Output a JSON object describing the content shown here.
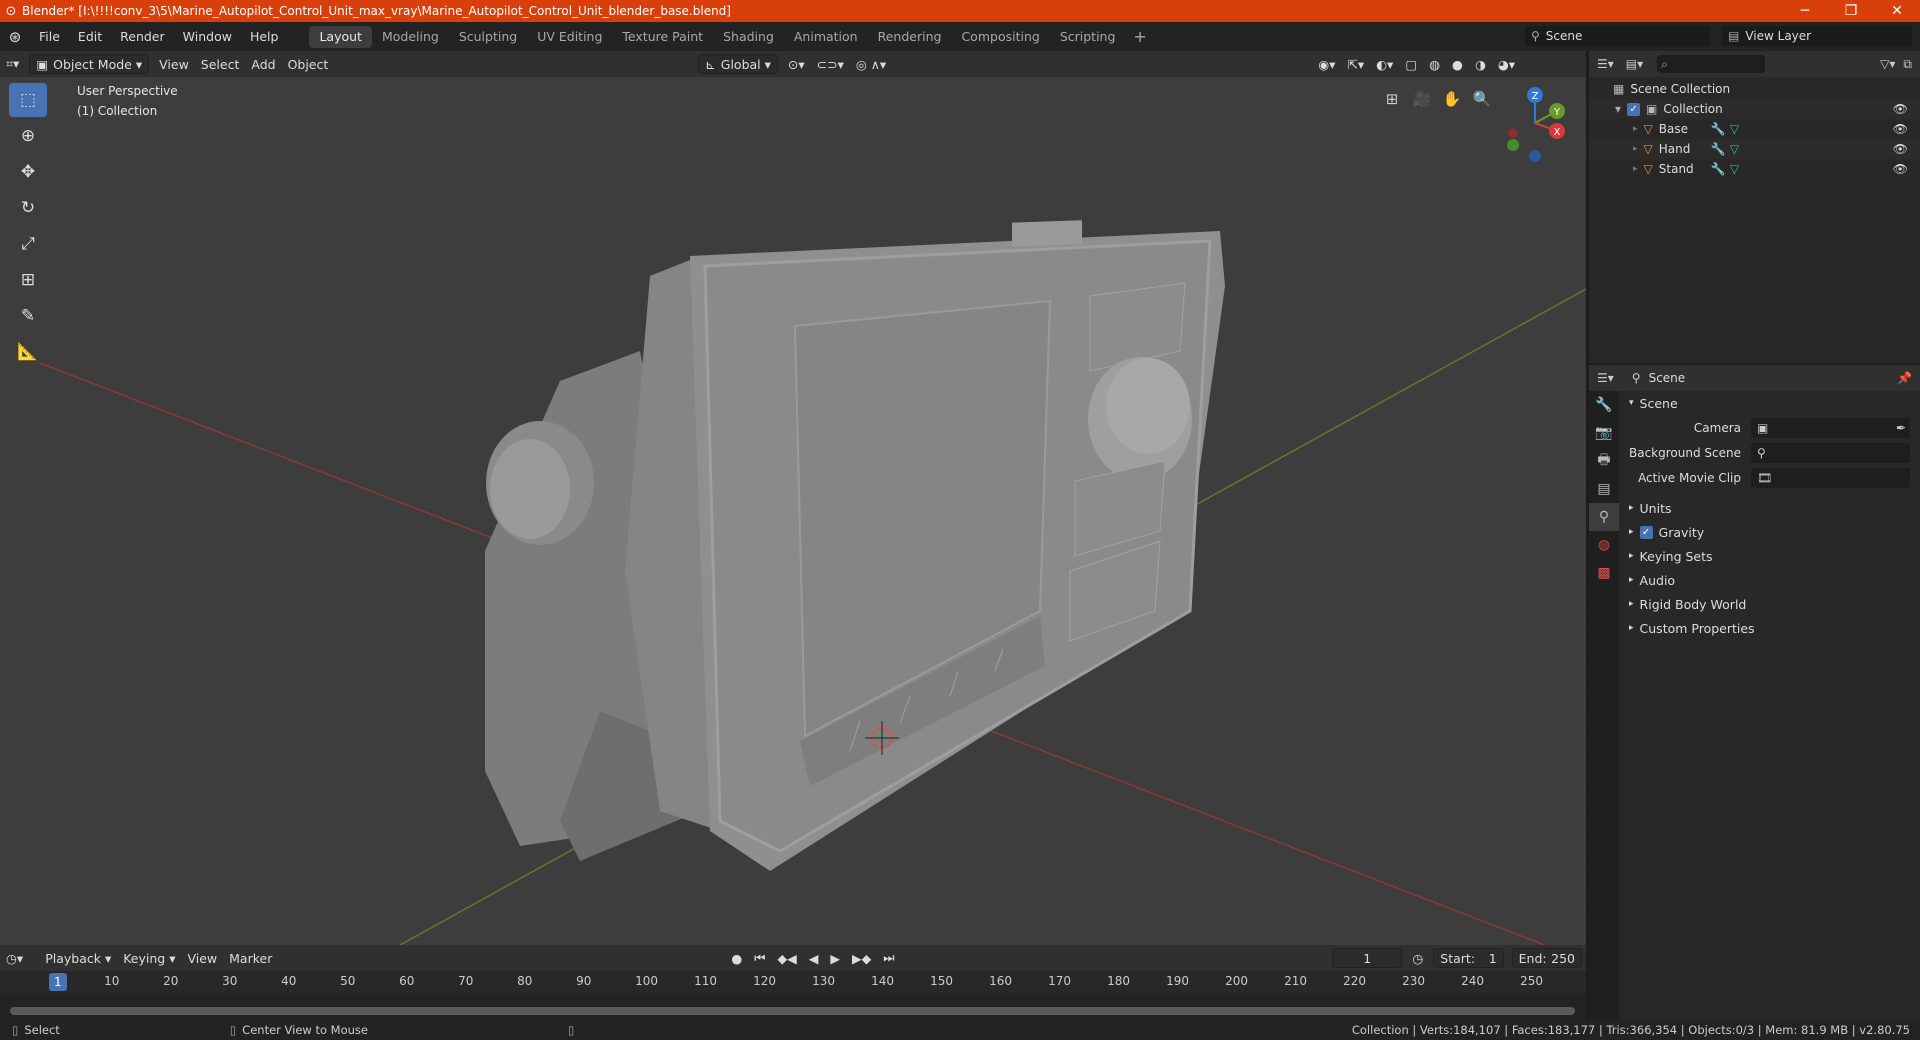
{
  "titlebar": {
    "title": "Blender* [I:\\!!!!conv_3\\5\\Marine_Autopilot_Control_Unit_max_vray\\Marine_Autopilot_Control_Unit_blender_base.blend]",
    "minimize": "─",
    "maximize": "❐",
    "close": "✕"
  },
  "menu": [
    "File",
    "Edit",
    "Render",
    "Window",
    "Help"
  ],
  "workspaces": [
    "Layout",
    "Modeling",
    "Sculpting",
    "UV Editing",
    "Texture Paint",
    "Shading",
    "Animation",
    "Rendering",
    "Compositing",
    "Scripting"
  ],
  "scene_name": "Scene",
  "view_layer": "View Layer",
  "viewport": {
    "mode": "Object Mode",
    "menus": [
      "View",
      "Select",
      "Add",
      "Object"
    ],
    "orientation": "Global",
    "perspective": "User Perspective",
    "collection": "(1) Collection",
    "gizmo": {
      "z": "Z",
      "y": "Y",
      "x": "X"
    }
  },
  "outliner": {
    "root": "Scene Collection",
    "collection": "Collection",
    "objects": [
      "Base",
      "Hand",
      "Stand"
    ]
  },
  "properties": {
    "header": "Scene",
    "section": "Scene",
    "fields": [
      {
        "label": "Camera",
        "value": ""
      },
      {
        "label": "Background Scene",
        "value": ""
      },
      {
        "label": "Active Movie Clip",
        "value": ""
      }
    ],
    "panels": [
      "Units",
      "Gravity",
      "Keying Sets",
      "Audio",
      "Rigid Body World",
      "Custom Properties"
    ]
  },
  "timeline": {
    "menus": [
      "Playback",
      "Keying",
      "View",
      "Marker"
    ],
    "current_frame": "1",
    "start_label": "Start:",
    "start": "1",
    "end_label": "End:",
    "end": "250",
    "ticks": [
      "10",
      "20",
      "30",
      "40",
      "50",
      "60",
      "70",
      "80",
      "90",
      "100",
      "110",
      "120",
      "130",
      "140",
      "150",
      "160",
      "170",
      "180",
      "190",
      "200",
      "210",
      "220",
      "230",
      "240",
      "250"
    ]
  },
  "statusbar": {
    "left": "Select",
    "middle": "Center View to Mouse",
    "right": "Collection | Verts:184,107 | Faces:183,177 | Tris:366,354 | Objects:0/3 | Mem: 81.9 MB | v2.80.75"
  }
}
